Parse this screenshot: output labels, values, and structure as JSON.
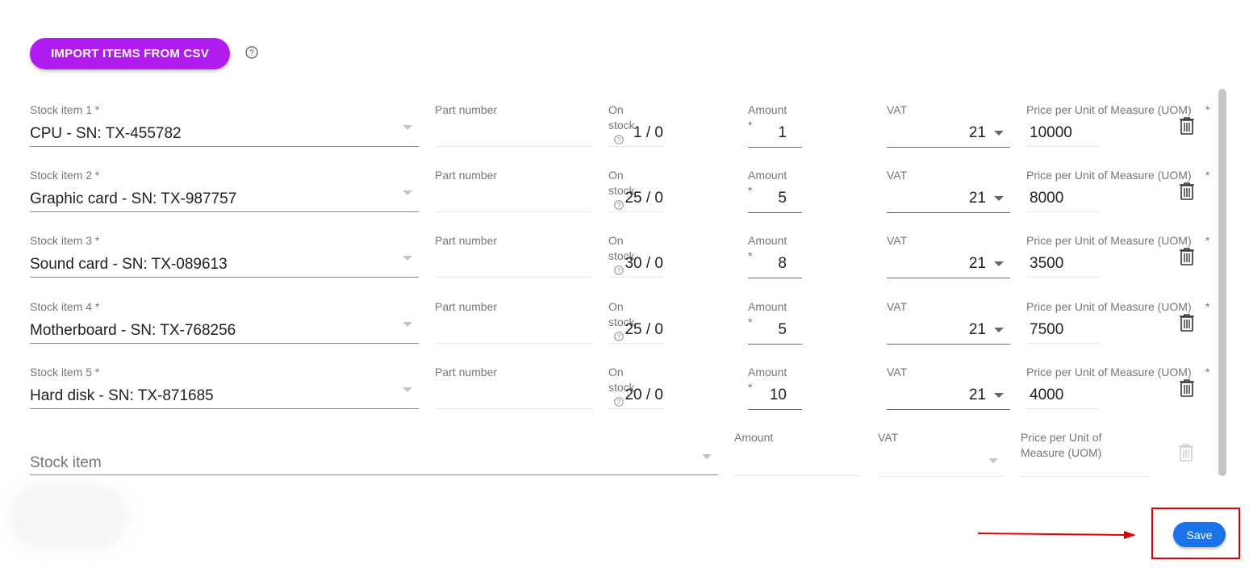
{
  "import_button": {
    "label": "IMPORT ITEMS FROM CSV",
    "help_icon": "help-circle-icon"
  },
  "labels": {
    "part_number": "Part number",
    "on": "On",
    "stock": "stock",
    "amount": "Amount",
    "required_mark": "*",
    "vat": "VAT",
    "price_uom": "Price per Unit of Measure (UOM)",
    "price_uom_star": "*"
  },
  "rows": [
    {
      "stock_label": "Stock item 1 *",
      "stock_value": "CPU - SN: TX-455782",
      "on_stock": "1 / 0",
      "amount": "1",
      "vat": "21",
      "price": "10000"
    },
    {
      "stock_label": "Stock item 2 *",
      "stock_value": "Graphic card - SN: TX-987757",
      "on_stock": "25 / 0",
      "amount": "5",
      "vat": "21",
      "price": "8000"
    },
    {
      "stock_label": "Stock item 3 *",
      "stock_value": "Sound card - SN: TX-089613",
      "on_stock": "30 / 0",
      "amount": "8",
      "vat": "21",
      "price": "3500"
    },
    {
      "stock_label": "Stock item 4 *",
      "stock_value": "Motherboard - SN: TX-768256",
      "on_stock": "25 / 0",
      "amount": "5",
      "vat": "21",
      "price": "7500"
    },
    {
      "stock_label": "Stock item 5 *",
      "stock_value": "Hard disk - SN: TX-871685",
      "on_stock": "20 / 0",
      "amount": "10",
      "vat": "21",
      "price": "4000"
    }
  ],
  "new_row": {
    "stock_placeholder": "Stock item",
    "amount_label": "Amount",
    "vat_label": "VAT",
    "price_label_line1": "Price per Unit of",
    "price_label_line2": "Measure (UOM)"
  },
  "save_button": {
    "label": "Save"
  },
  "colors": {
    "import_button": "#b01cf0",
    "save_button": "#1a73e8",
    "annotation": "#e00000"
  }
}
